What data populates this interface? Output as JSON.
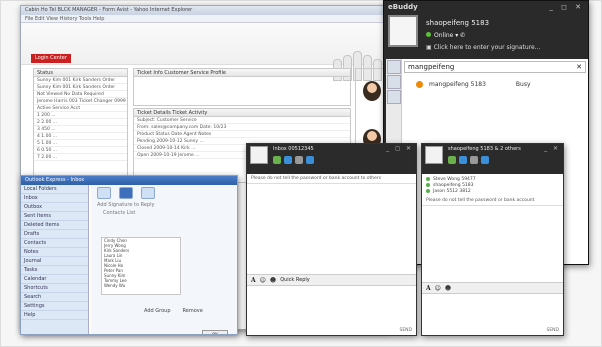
{
  "browser": {
    "title": "Cabin Ho Tel BLCK MANAGER - Form Avist - Yahoo Internet Explorer",
    "menu": "File  Edit  View  History  Tools  Help",
    "red_button": "Login Center",
    "left_panel_title": "Status",
    "rows": [
      "Sunny Kim 001  Kirk Sanders Order",
      "Sunny Kim 001  Kirk Sanders Order",
      "Not Viewed  No Data Required",
      "Jerome Harris 003  Ticket Changer 0999",
      "Active Service Acct"
    ],
    "grid_rows": [
      "1  200  ...",
      "2  2.00  ...",
      "3  450  ...",
      "4  1.00  ...",
      "5  1.00  ...",
      "6  0.50  ...",
      "7  2.00  ..."
    ],
    "mid_panel_title": "Ticket Info   Customer Service Profile",
    "mid2_panel_title": "Ticket Details   Ticket Activity",
    "mid2_lines": [
      "Subject: Customer Service",
      "From: sales@company.com   Date: 10/23",
      "Product Status   Date   Agent   Notes",
      "Pending   2009-10-12   Sunny   ...",
      "Closed   2009-10-14   Kirk   ...",
      "Open   2009-10-19   Jerome   ..."
    ]
  },
  "app": {
    "title": "Outlook Express - Inbox",
    "sidebar_items": [
      "Local Folders",
      "Inbox",
      "Outbox",
      "Sent Items",
      "Deleted Items",
      "Drafts",
      "Contacts",
      "Notes",
      "Journal",
      "Tasks",
      "Calendar",
      "Shortcuts",
      "Search",
      "Settings",
      "Help"
    ],
    "heading": "Add Signature to Reply",
    "subheading": "Contacts List",
    "list_items": [
      "Cindy Chen",
      "Jerry Wong",
      "Kirk Sanders",
      "Laura Lin",
      "Mark Liu",
      "Nicole Ho",
      "Peter Pan",
      "Sunny Kim",
      "Tommy Lee",
      "Wendy Wu"
    ],
    "btn_add": "Add Group",
    "btn_remove": "Remove",
    "ok_label": "OK"
  },
  "buddy": {
    "brand": "eBuddy",
    "window_controls": "_ ◻ ✕",
    "username": "shaopeifeng 5183",
    "status": "Online",
    "signature": "Click here to enter your signature...",
    "search_text": "mangpeifeng",
    "search_close": "✕",
    "contact_name": "mangpeifeng 5183",
    "contact_status": "Busy"
  },
  "chat1": {
    "title": "Inbox 00512345",
    "notice": "Please do not tell the password or bank account to others",
    "quick_reply": "Quick Reply",
    "send": "SEND"
  },
  "chat2": {
    "title": "shaopeifeng 5183 & 2 others",
    "members": [
      "Steve Wong 59477",
      "shaopeifeng 5183",
      "Jason 5512 3812"
    ],
    "notice": "Please do not tell the password or bank account",
    "send": "SEND"
  }
}
